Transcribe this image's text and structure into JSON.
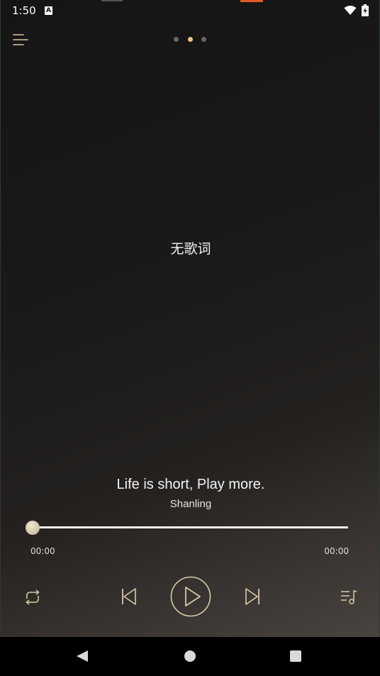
{
  "status_bar": {
    "time": "1:50",
    "notification_icon": "A",
    "icons": [
      "wifi-icon",
      "battery-charging-icon"
    ]
  },
  "header": {
    "menu_icon": "menu-icon",
    "page_indicator": {
      "count": 3,
      "active_index": 1
    }
  },
  "lyrics": {
    "empty_text": "无歌词"
  },
  "track": {
    "title": "Life is short, Play more.",
    "artist": "Shanling"
  },
  "progress": {
    "elapsed": "00:00",
    "total": "00:00",
    "fraction": 0.0
  },
  "controls": {
    "repeat_icon": "repeat-icon",
    "previous_icon": "skip-previous-icon",
    "play_icon": "play-icon",
    "next_icon": "skip-next-icon",
    "playlist_icon": "playlist-icon"
  },
  "nav_bar": {
    "icons": [
      "back-icon",
      "home-icon",
      "recents-icon"
    ]
  },
  "colors": {
    "accent": "#f0c48a",
    "control_stroke": "#d8c9a8",
    "recording_indicator": "#e35b2a"
  }
}
